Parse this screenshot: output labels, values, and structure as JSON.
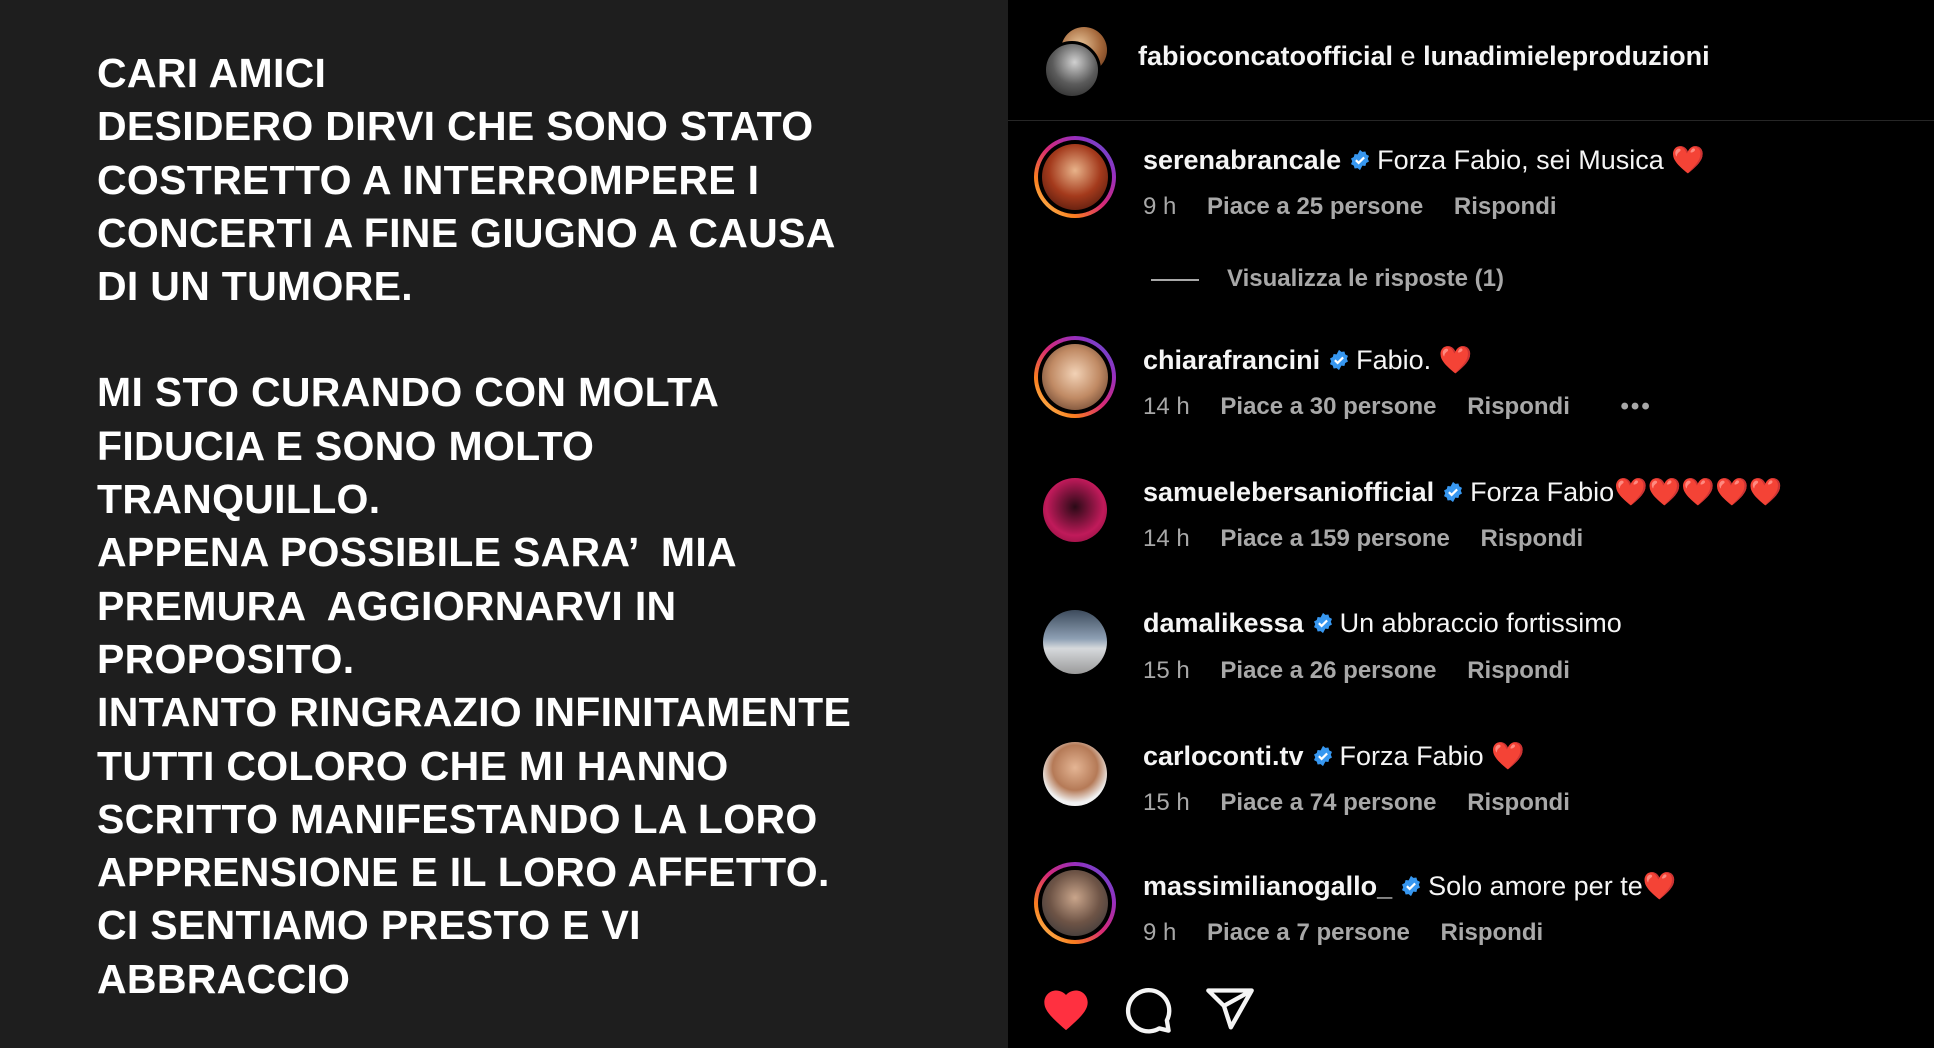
{
  "post": {
    "paragraphs": [
      {
        "lines": [
          "CARI AMICI",
          "DESIDERO DIRVI CHE SONO STATO",
          "COSTRETTO A INTERROMPERE I",
          "CONCERTI A FINE GIUGNO A CAUSA",
          "DI UN TUMORE."
        ]
      },
      {
        "lines": [
          "MI STO CURANDO CON MOLTA",
          "FIDUCIA E SONO MOLTO",
          "TRANQUILLO.",
          "APPENA POSSIBILE SARA’  MIA",
          "PREMURA  AGGIORNARVI IN",
          "PROPOSITO.",
          "INTANTO RINGRAZIO INFINITAMENTE",
          "TUTTI COLORO CHE MI HANNO",
          "SCRITTO MANIFESTANDO LA LORO",
          "APPRENSIONE E IL LORO AFFETTO.",
          "CI SENTIAMO PRESTO E VI",
          "ABBRACCIO"
        ]
      }
    ]
  },
  "header": {
    "author1": "fabioconcatoofficial",
    "joiner": "e",
    "author2": "lunadimieleproduzioni"
  },
  "comments": [
    {
      "user": "serenabrancale",
      "text": "Forza Fabio, sei Musica ❤️",
      "time": "9 h",
      "likes": "Piace a 25 persone",
      "reply": "Rispondi",
      "view_replies": "Visualizza le risposte (1)"
    },
    {
      "user": "chiarafrancini",
      "text": "Fabio. ❤️",
      "time": "14 h",
      "likes": "Piace a 30 persone",
      "reply": "Rispondi",
      "more": "•••"
    },
    {
      "user": "samuelebersaniofficial",
      "text": "Forza Fabio❤️❤️❤️❤️❤️",
      "time": "14 h",
      "likes": "Piace a 159 persone",
      "reply": "Rispondi"
    },
    {
      "user": "damalikessa",
      "text": "Un abbraccio fortissimo",
      "time": "15 h",
      "likes": "Piace a 26 persone",
      "reply": "Rispondi"
    },
    {
      "user": "carloconti.tv",
      "text": "Forza Fabio ❤️",
      "time": "15 h",
      "likes": "Piace a 74 persone",
      "reply": "Rispondi"
    },
    {
      "user": "massimilianogallo_",
      "text": "Solo amore per te❤️",
      "time": "9 h",
      "likes": "Piace a 7 persone",
      "reply": "Rispondi"
    }
  ],
  "actions": {
    "like_icon": "heart-filled-icon",
    "comment_icon": "comment-bubble-icon",
    "share_icon": "paper-plane-icon",
    "like_color": "#ff3040"
  },
  "colors": {
    "post_bg": "#1e1e1e",
    "panel_bg": "#000000",
    "verified": "#3797f0",
    "secondary_text": "#a8a8a8"
  }
}
